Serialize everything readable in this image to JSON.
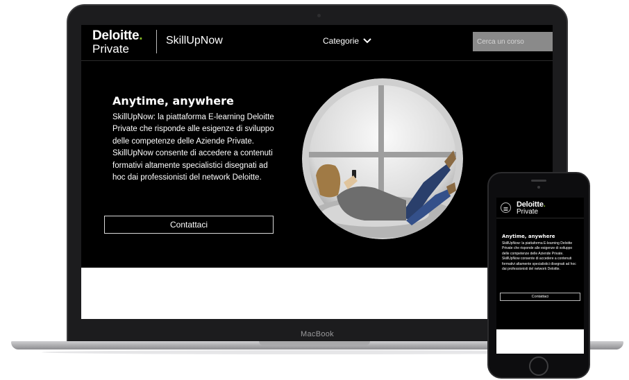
{
  "laptop": {
    "brand_label": "MacBook",
    "header": {
      "logo_name": "Deloitte",
      "logo_dot": ".",
      "logo_sub": "Private",
      "product_name": "SkillUpNow",
      "categories_label": "Categorie",
      "search_placeholder": "Cerca un corso"
    },
    "hero": {
      "title": "Anytime, anywhere",
      "body": "SkillUpNow: la piattaforma E-learning Deloitte Private che risponde alle esigenze di sviluppo delle competenze delle Aziende Private. SkillUpNow consente di accedere a contenuti formativi altamente specialistici disegnati ad hoc dai professionisti del network Deloitte.",
      "cta_label": "Contattaci"
    }
  },
  "phone": {
    "header": {
      "logo_name": "Deloitte",
      "logo_dot": ".",
      "logo_sub": "Private"
    },
    "hero": {
      "title": "Anytime, anywhere",
      "body": "SkillUpNow: la piattaforma E-learning Deloitte Private che risponde alle esigenze di sviluppo delle competenze delle Aziende Private. SkillUpNow consente di accedere a contenuti formativi altamente specialistici disegnati ad hoc dai professionisti del network Deloitte.",
      "cta_label": "Contattaci"
    }
  },
  "colors": {
    "background": "#000000",
    "accent_green": "#86bc25",
    "search_bg": "#8a8a8a"
  }
}
